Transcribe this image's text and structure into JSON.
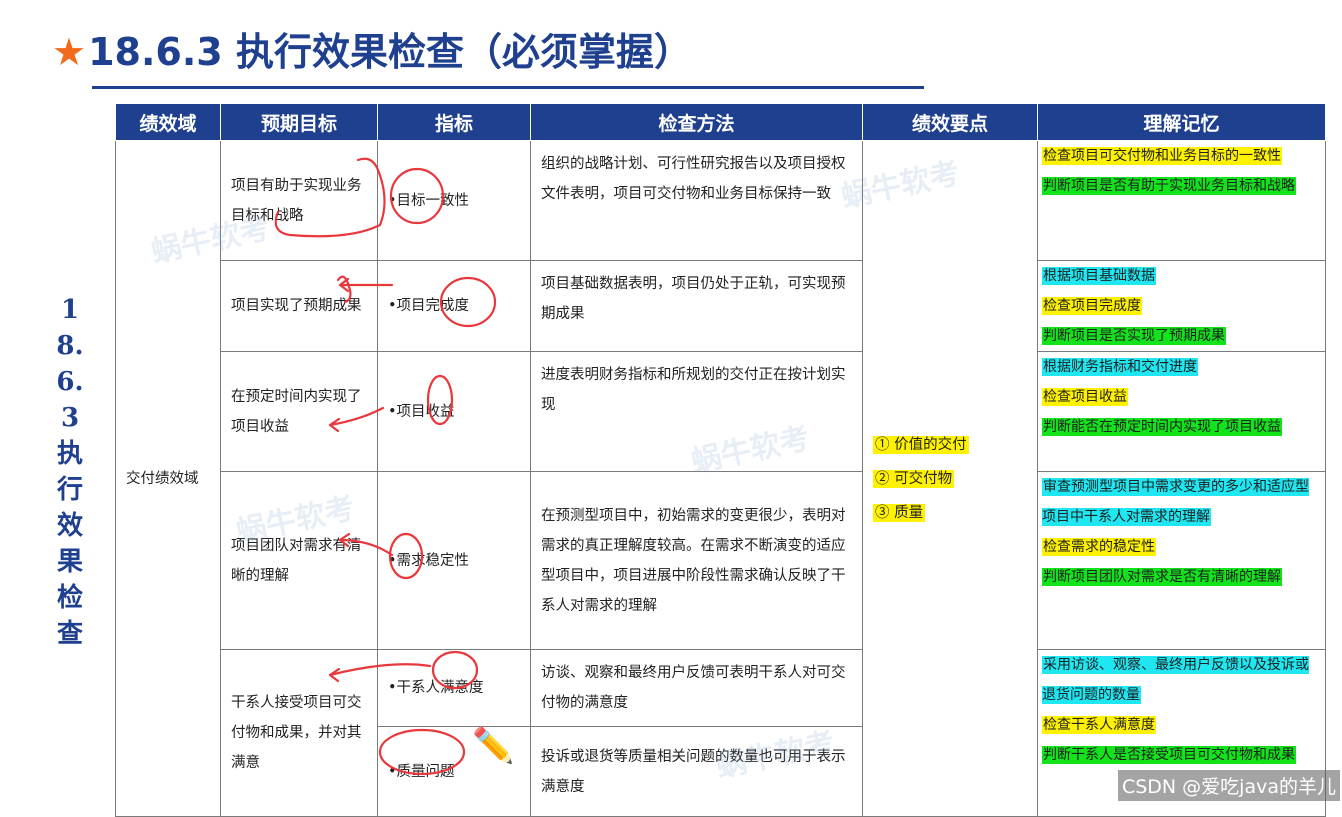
{
  "title": {
    "star": "★",
    "text": "18.6.3 执行效果检查（必须掌握）"
  },
  "side_label": "18.6.3执行效果检查",
  "headers": [
    "绩效域",
    "预期目标",
    "指标",
    "检查方法",
    "绩效要点",
    "理解记忆"
  ],
  "domain": "交付绩效域",
  "key_points": [
    "① 价值的交付",
    "② 可交付物",
    "③ 质量"
  ],
  "rows": [
    {
      "goal": "项目有助于实现业务目标和战略",
      "indicator": "•目标一致性",
      "method": "组织的战略计划、可行性研究报告以及项目授权文件表明，项目可交付物和业务目标保持一致",
      "memory": [
        {
          "text": "检查项目可交付物和业务目标的一致性",
          "color": "yellow"
        },
        {
          "text": "判断项目是否有助于实现业务目标和战略",
          "color": "green"
        }
      ]
    },
    {
      "goal": "项目实现了预期成果",
      "indicator": "•项目完成度",
      "method": "项目基础数据表明，项目仍处于正轨，可实现预期成果",
      "memory": [
        {
          "text": "根据项目基础数据",
          "color": "cyan"
        },
        {
          "text": "检查项目完成度",
          "color": "yellow"
        },
        {
          "text": "判断项目是否实现了预期成果",
          "color": "green"
        }
      ]
    },
    {
      "goal": "在预定时间内实现了项目收益",
      "indicator": "•项目收益",
      "method": "进度表明财务指标和所规划的交付正在按计划实现",
      "memory": [
        {
          "text": "根据财务指标和交付进度",
          "color": "cyan"
        },
        {
          "text": "检查项目收益",
          "color": "yellow"
        },
        {
          "text": "判断能否在预定时间内实现了项目收益",
          "color": "green"
        }
      ]
    },
    {
      "goal": "项目团队对需求有清晰的理解",
      "indicator": "•需求稳定性",
      "method": "在预测型项目中，初始需求的变更很少，表明对需求的真正理解度较高。在需求不断演变的适应型项目中，项目进展中阶段性需求确认反映了干系人对需求的理解",
      "memory": [
        {
          "text": "审查预测型项目中需求变更的多少和适应型项目中干系人对需求的理解",
          "color": "cyan"
        },
        {
          "text": "检查需求的稳定性",
          "color": "yellow"
        },
        {
          "text": "判断项目团队对需求是否有清晰的理解",
          "color": "green"
        }
      ]
    }
  ],
  "last": {
    "goal": "干系人接受项目可交付物和成果，并对其满意",
    "indicator_a": "•干系人满意度",
    "method_a": "访谈、观察和最终用户反馈可表明干系人对可交付物的满意度",
    "indicator_b": "•质量问题",
    "method_b": "投诉或退货等质量相关问题的数量也可用于表示满意度",
    "memory": [
      {
        "text": "采用访谈、观察、最终用户反馈以及投诉或退货问题的数量",
        "color": "cyan"
      },
      {
        "text": "检查干系人满意度",
        "color": "yellow"
      },
      {
        "text": "判断干系人是否接受项目可交付物和成果",
        "color": "green"
      }
    ]
  },
  "watermark": "蜗牛软考",
  "csdn": "CSDN @爱吃java的羊儿"
}
